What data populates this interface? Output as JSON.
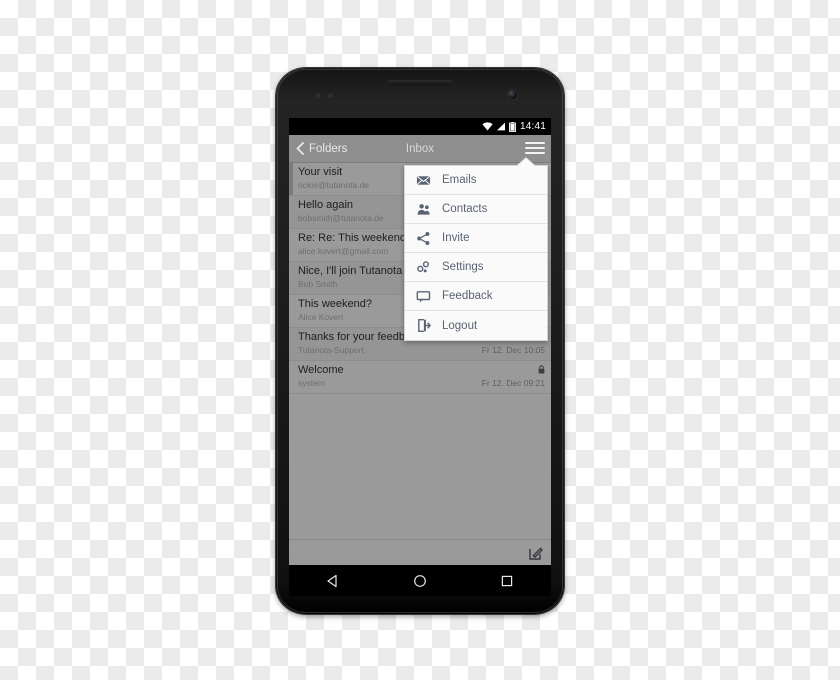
{
  "device": {
    "name": "android-smartphone",
    "frame_color": "#1a1a1a"
  },
  "status_bar": {
    "time": "14:41",
    "icons": [
      "wifi-icon",
      "signal-icon",
      "battery-icon"
    ]
  },
  "action_bar": {
    "back_label": "Folders",
    "title": "Inbox",
    "menu_icon": "hamburger-icon"
  },
  "mail_list": {
    "rows": [
      {
        "subject": "Your visit",
        "sender": "rickie@tutanota.de",
        "date": "",
        "locked": false
      },
      {
        "subject": "Hello again",
        "sender": "bobsmith@tutanota.de",
        "date": "",
        "locked": false
      },
      {
        "subject": "Re: Re: This weekend?",
        "sender": "alice.kovert@gmail.com",
        "date": "",
        "locked": false
      },
      {
        "subject": "Nice, I'll join Tutanota",
        "sender": "Bob Smith",
        "date": "",
        "locked": false
      },
      {
        "subject": "This weekend?",
        "sender": "Alice Kovert",
        "date": "",
        "locked": false
      },
      {
        "subject": "Thanks for your feedback",
        "sender": "Tutanota-Support",
        "date": "Fr 12. Dec 10:05",
        "locked": true
      },
      {
        "subject": "Welcome",
        "sender": "system",
        "date": "Fr 12. Dec 09:21",
        "locked": true
      }
    ]
  },
  "menu": {
    "items": [
      {
        "label": "Emails",
        "icon": "envelope-icon"
      },
      {
        "label": "Contacts",
        "icon": "contacts-icon"
      },
      {
        "label": "Invite",
        "icon": "share-icon"
      },
      {
        "label": "Settings",
        "icon": "settings-icon"
      },
      {
        "label": "Feedback",
        "icon": "speech-bubble-icon"
      },
      {
        "label": "Logout",
        "icon": "logout-icon"
      }
    ]
  },
  "app_bottom_bar": {
    "compose_icon": "compose-icon"
  },
  "nav_bar": {
    "buttons": [
      "back-triangle-icon",
      "home-circle-icon",
      "recents-square-icon"
    ]
  },
  "colors": {
    "screen_bg": "#9a9a9a",
    "action_bar": "#8e8e8e",
    "menu_bg": "#fafafa",
    "menu_text": "#5a6474"
  }
}
